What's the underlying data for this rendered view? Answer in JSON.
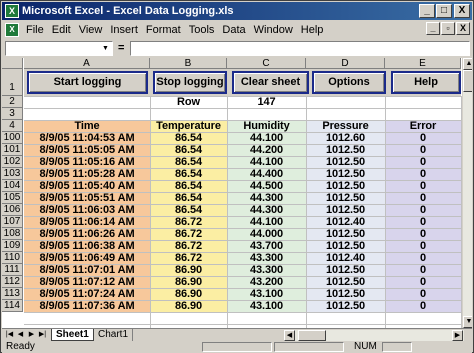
{
  "window": {
    "title": "Microsoft Excel - Excel Data Logging.xls",
    "min": "_",
    "max": "□",
    "close": "X"
  },
  "menu": {
    "items": [
      "File",
      "Edit",
      "View",
      "Insert",
      "Format",
      "Tools",
      "Data",
      "Window",
      "Help"
    ],
    "doc_min": "_",
    "doc_restore": "▫",
    "doc_close": "X"
  },
  "formula": {
    "eq": "=",
    "namebox_value": "",
    "content": ""
  },
  "columns": [
    "A",
    "B",
    "C",
    "D",
    "E"
  ],
  "buttons": {
    "start": "Start logging",
    "stop": "Stop logging",
    "clear": "Clear sheet",
    "options": "Options",
    "help": "Help"
  },
  "row2": {
    "label": "Row",
    "value": "147"
  },
  "headers": {
    "time": "Time",
    "temperature": "Temperature",
    "humidity": "Humidity",
    "pressure": "Pressure",
    "error": "Error"
  },
  "row_numbers": {
    "r1": "1",
    "r2": "2",
    "r3": "3",
    "r4": "4"
  },
  "data_rows": [
    {
      "row": "100",
      "time": "8/9/05 11:04:53 AM",
      "temp": "86.54",
      "hum": "44.100",
      "pres": "1012.60",
      "err": "0"
    },
    {
      "row": "101",
      "time": "8/9/05 11:05:05 AM",
      "temp": "86.54",
      "hum": "44.200",
      "pres": "1012.50",
      "err": "0"
    },
    {
      "row": "102",
      "time": "8/9/05 11:05:16 AM",
      "temp": "86.54",
      "hum": "44.100",
      "pres": "1012.50",
      "err": "0"
    },
    {
      "row": "103",
      "time": "8/9/05 11:05:28 AM",
      "temp": "86.54",
      "hum": "44.400",
      "pres": "1012.50",
      "err": "0"
    },
    {
      "row": "104",
      "time": "8/9/05 11:05:40 AM",
      "temp": "86.54",
      "hum": "44.500",
      "pres": "1012.50",
      "err": "0"
    },
    {
      "row": "105",
      "time": "8/9/05 11:05:51 AM",
      "temp": "86.54",
      "hum": "44.300",
      "pres": "1012.50",
      "err": "0"
    },
    {
      "row": "106",
      "time": "8/9/05 11:06:03 AM",
      "temp": "86.54",
      "hum": "44.300",
      "pres": "1012.50",
      "err": "0"
    },
    {
      "row": "107",
      "time": "8/9/05 11:06:14 AM",
      "temp": "86.72",
      "hum": "44.100",
      "pres": "1012.40",
      "err": "0"
    },
    {
      "row": "108",
      "time": "8/9/05 11:06:26 AM",
      "temp": "86.72",
      "hum": "44.000",
      "pres": "1012.50",
      "err": "0"
    },
    {
      "row": "109",
      "time": "8/9/05 11:06:38 AM",
      "temp": "86.72",
      "hum": "43.700",
      "pres": "1012.50",
      "err": "0"
    },
    {
      "row": "110",
      "time": "8/9/05 11:06:49 AM",
      "temp": "86.72",
      "hum": "43.300",
      "pres": "1012.40",
      "err": "0"
    },
    {
      "row": "111",
      "time": "8/9/05 11:07:01 AM",
      "temp": "86.90",
      "hum": "43.300",
      "pres": "1012.50",
      "err": "0"
    },
    {
      "row": "112",
      "time": "8/9/05 11:07:12 AM",
      "temp": "86.90",
      "hum": "43.200",
      "pres": "1012.50",
      "err": "0"
    },
    {
      "row": "113",
      "time": "8/9/05 11:07:24 AM",
      "temp": "86.90",
      "hum": "43.100",
      "pres": "1012.50",
      "err": "0"
    },
    {
      "row": "114",
      "time": "8/9/05 11:07:36 AM",
      "temp": "86.90",
      "hum": "43.100",
      "pres": "1012.50",
      "err": "0"
    }
  ],
  "colors": {
    "time_bg": "#f7c89b",
    "temp_bg": "#fbeea3",
    "hum_bg": "#dfeedd",
    "pres_bg": "#e4e8f2",
    "err_bg": "#d8d4ec",
    "title_start": "#0a246a",
    "title_end": "#3a6ea5",
    "button_border": "#1b2a8a"
  },
  "sheets": {
    "active": "Sheet1",
    "other": "Chart1"
  },
  "status": {
    "ready": "Ready",
    "num": "NUM"
  },
  "icons": {
    "app": "excel-icon",
    "nav_first": "first-sheet-icon",
    "nav_prev": "prev-sheet-icon",
    "nav_next": "next-sheet-icon",
    "nav_last": "last-sheet-icon"
  }
}
